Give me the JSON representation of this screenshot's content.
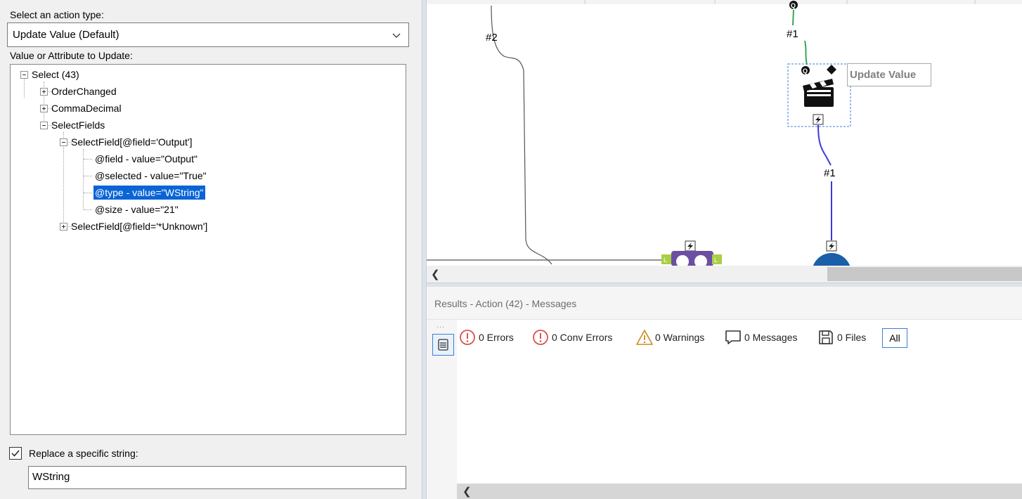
{
  "config": {
    "action_type_label": "Select an action type:",
    "action_type_value": "Update Value (Default)",
    "value_attr_label": "Value or Attribute to Update:",
    "tree": [
      {
        "label": "Select (43)",
        "state": "expanded"
      },
      {
        "label": "OrderChanged",
        "state": "collapsed"
      },
      {
        "label": "CommaDecimal",
        "state": "collapsed"
      },
      {
        "label": "SelectFields",
        "state": "expanded"
      },
      {
        "label": "SelectField[@field='Output']",
        "state": "expanded"
      },
      {
        "label": "@field - value=\"Output\"",
        "state": "leaf"
      },
      {
        "label": "@selected - value=\"True\"",
        "state": "leaf"
      },
      {
        "label": "@type - value=\"WString\"",
        "state": "leaf",
        "selected": true
      },
      {
        "label": "@size - value=\"21\"",
        "state": "leaf"
      },
      {
        "label": "SelectField[@field='*Unknown']",
        "state": "collapsed"
      }
    ],
    "replace_label": "Replace a specific string:",
    "replace_checked": true,
    "replace_value": "WString"
  },
  "canvas": {
    "tooltip": "Update Value",
    "connection_labels": [
      "#2",
      "#1",
      "#1"
    ],
    "tool_icons": [
      "clapperboard-icon",
      "lightning-icon",
      "join-tool-icon",
      "browse-tool-icon"
    ]
  },
  "results": {
    "title": "Results - Action (42) - Messages",
    "filters": [
      {
        "label": "0 Errors",
        "icon": "error-icon"
      },
      {
        "label": "0 Conv Errors",
        "icon": "conv-error-icon"
      },
      {
        "label": "0 Warnings",
        "icon": "warning-icon"
      },
      {
        "label": "0 Messages",
        "icon": "message-icon"
      },
      {
        "label": "0 Files",
        "icon": "file-icon"
      }
    ],
    "all_label": "All",
    "side_dots": "..."
  },
  "colors": {
    "selection": "#0a64d6",
    "accent": "#3b7dd8",
    "error": "#d9534f",
    "warning": "#c98b1f",
    "conn_green": "#3aa655",
    "conn_blue": "#3a3adb",
    "join_purple": "#6b4fa3",
    "lime": "#a8cf45"
  }
}
